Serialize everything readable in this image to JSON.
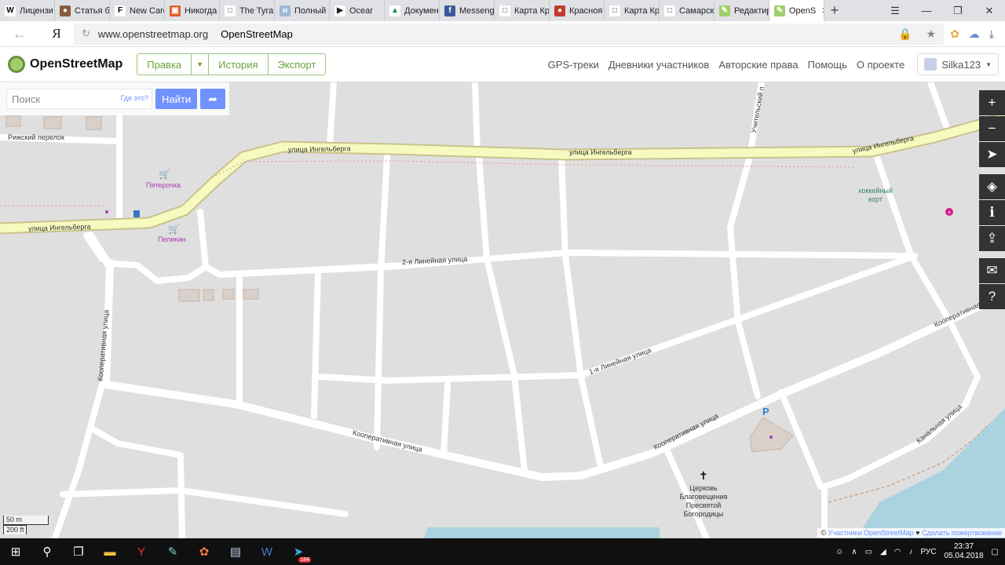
{
  "browser": {
    "tabs": [
      {
        "label": "Лицензи",
        "fav": "W",
        "fav_bg": "#ffffff",
        "fav_color": "#000000"
      },
      {
        "label": "Статья б",
        "fav": "●",
        "fav_bg": "#8a5a3c",
        "fav_color": "#ffffff"
      },
      {
        "label": "New Carc",
        "fav": "F",
        "fav_bg": "#ffffff",
        "fav_color": "#000000"
      },
      {
        "label": "Никогда",
        "fav": "▣",
        "fav_bg": "#e25b2b",
        "fav_color": "#ffffff"
      },
      {
        "label": "The Tyrar",
        "fav": "□",
        "fav_bg": "#ffffff",
        "fav_color": "#555555"
      },
      {
        "label": "Полный",
        "fav": "н",
        "fav_bg": "#9fb9d9",
        "fav_color": "#ffffff"
      },
      {
        "label": "Ocear",
        "fav": "▶",
        "fav_bg": "#ffffff",
        "fav_color": "#222222"
      },
      {
        "label": "Докумен",
        "fav": "▲",
        "fav_bg": "#ffffff",
        "fav_color": "#1e8e3e"
      },
      {
        "label": "Messeng",
        "fav": "f",
        "fav_bg": "#3b5998",
        "fav_color": "#ffffff"
      },
      {
        "label": "Карта Кр",
        "fav": "□",
        "fav_bg": "#ffffff",
        "fav_color": "#555555"
      },
      {
        "label": "Красноя",
        "fav": "●",
        "fav_bg": "#c23b2b",
        "fav_color": "#ffffff"
      },
      {
        "label": "Карта Кр",
        "fav": "□",
        "fav_bg": "#ffffff",
        "fav_color": "#555555"
      },
      {
        "label": "Самарск",
        "fav": "□",
        "fav_bg": "#ffffff",
        "fav_color": "#555555"
      },
      {
        "label": "Редактир",
        "fav": "✎",
        "fav_bg": "#9fcf6a",
        "fav_color": "#ffffff"
      },
      {
        "label": "OpenS",
        "fav": "✎",
        "fav_bg": "#9fcf6a",
        "fav_color": "#ffffff",
        "active": true
      }
    ],
    "url_host": "www.openstreetmap.org",
    "page_title": "OpenStreetMap",
    "ya_logo": "Я"
  },
  "osm": {
    "brand": "OpenStreetMap",
    "edit_label": "Правка",
    "history_label": "История",
    "export_label": "Экспорт",
    "nav": [
      "GPS-треки",
      "Дневники участников",
      "Авторские права",
      "Помощь",
      "О проекте"
    ],
    "username": "Silka123"
  },
  "search": {
    "placeholder": "Поиск",
    "where_is": "Где это?",
    "find_label": "Найти"
  },
  "map": {
    "labels": {
      "ingelberga_1": "улица Ингельберга",
      "ingelberga_2": "улица Ингельберга",
      "ingelberga_3": "улица Ингельберга",
      "ingelberga_4": "улица Ингельберга",
      "rizhsky": "Рижский перелок",
      "pyaterochka": "Пятерочка",
      "pelikan": "Пеликан",
      "line2": "2-я Линейная улица",
      "line1": "1-я Линейная улица",
      "coop_v": "Кооперативная улица",
      "coop_1": "Кооперативная улица",
      "coop_2": "Кооперативная улица",
      "coop_3": "Кооперативная улица",
      "kanalnaya": "Канальная улица",
      "uchitelsky": "Учительский п",
      "hockey": "хоккейный корт",
      "church": "Церковь Благовещения Пресвятой Богородицы",
      "parking": "P"
    },
    "scale_m": "50 m",
    "scale_ft": "200 ft",
    "attribution_prefix": "©",
    "attribution_link": "Участники OpenStreetMap",
    "attribution_sep": "♥",
    "donate_link": "Сделать пожертвование"
  },
  "taskbar": {
    "lang": "РУС",
    "time": "23:37",
    "date": "05.04.2018",
    "telegram_badge": "184"
  }
}
